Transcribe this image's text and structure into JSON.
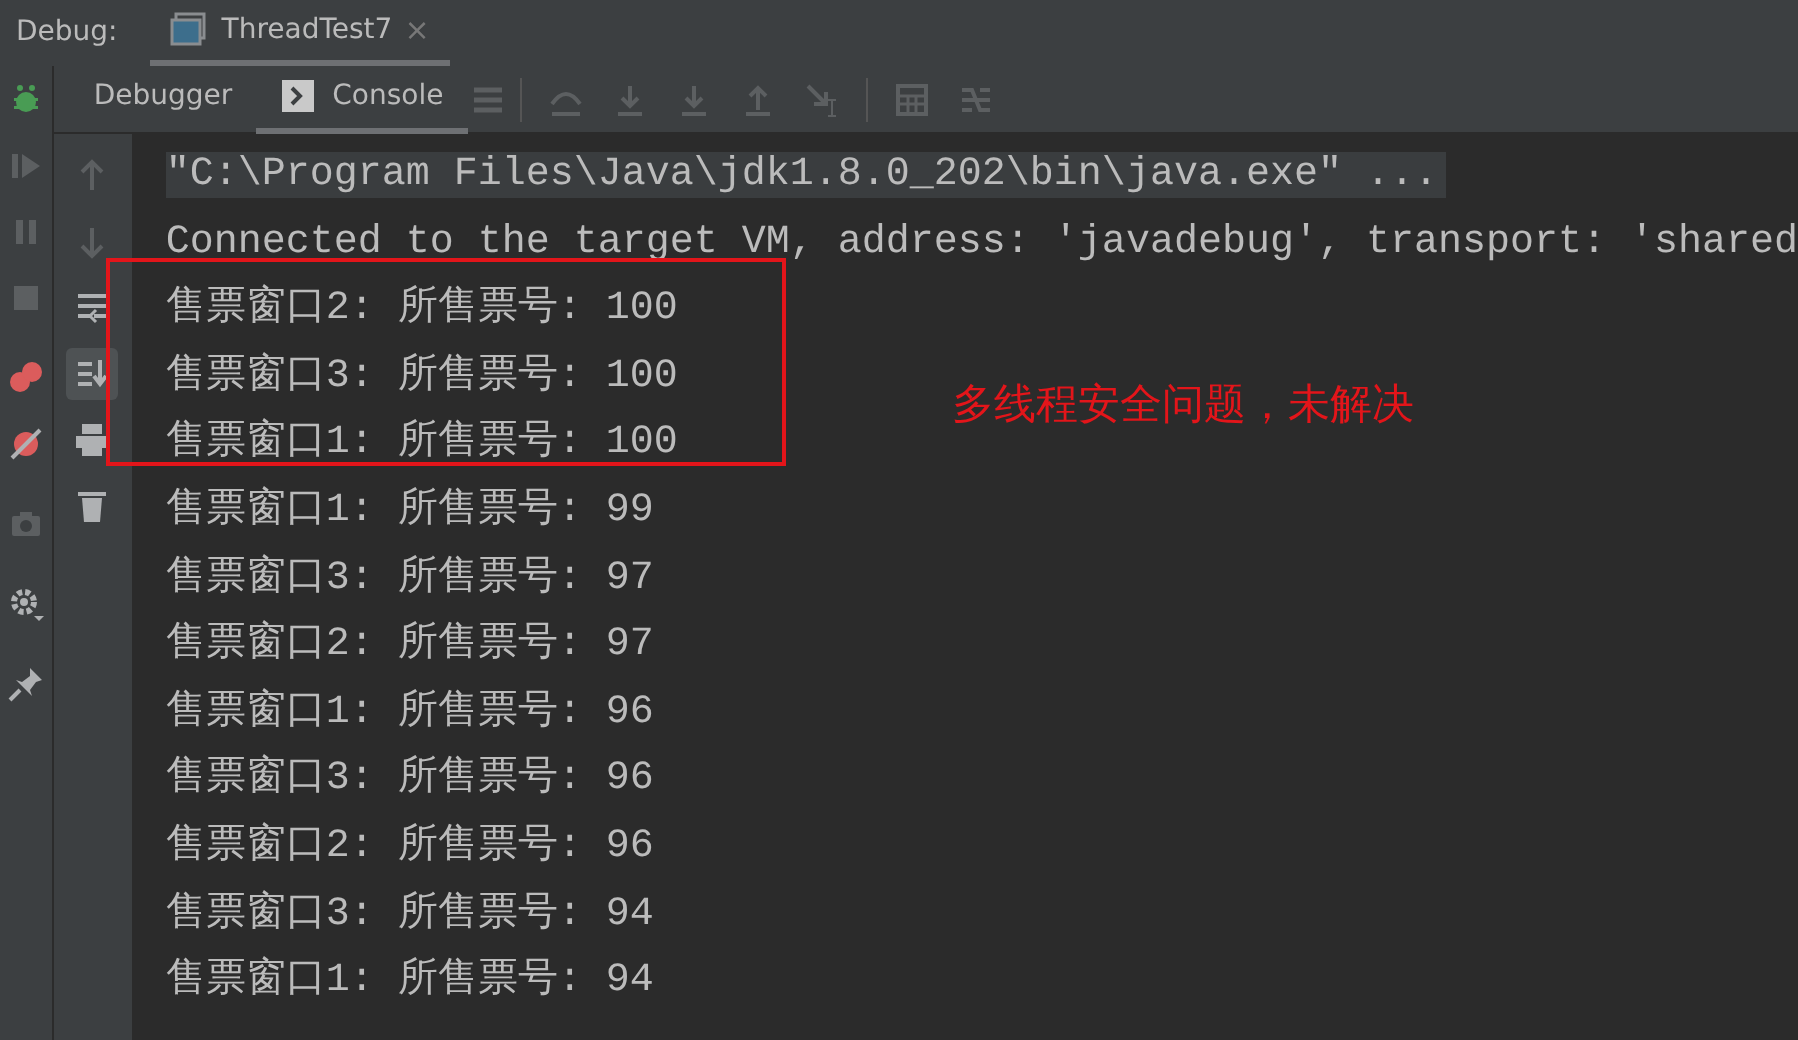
{
  "debug_bar": {
    "label": "Debug:",
    "tab": {
      "title": "ThreadTest7",
      "close": "×"
    }
  },
  "tool_tabs": [
    {
      "label": "Debugger",
      "selected": false
    },
    {
      "label": "Console",
      "selected": true
    }
  ],
  "console": {
    "lines": [
      {
        "text": "\"C:\\Program Files\\Java\\jdk1.8.0_202\\bin\\java.exe\" ...",
        "kind": "command"
      },
      {
        "text": "Connected to the target VM, address: 'javadebug', transport: 'shared",
        "kind": "output"
      },
      {
        "text": "售票窗口2: 所售票号: 100",
        "kind": "output"
      },
      {
        "text": "售票窗口3: 所售票号: 100",
        "kind": "output"
      },
      {
        "text": "售票窗口1: 所售票号: 100",
        "kind": "output"
      },
      {
        "text": "售票窗口1: 所售票号: 99",
        "kind": "output"
      },
      {
        "text": "售票窗口3: 所售票号: 97",
        "kind": "output"
      },
      {
        "text": "售票窗口2: 所售票号: 97",
        "kind": "output"
      },
      {
        "text": "售票窗口1: 所售票号: 96",
        "kind": "output"
      },
      {
        "text": "售票窗口3: 所售票号: 96",
        "kind": "output"
      },
      {
        "text": "售票窗口2: 所售票号: 96",
        "kind": "output"
      },
      {
        "text": "售票窗口3: 所售票号: 94",
        "kind": "output"
      },
      {
        "text": "售票窗口1: 所售票号: 94",
        "kind": "output"
      }
    ]
  },
  "annotation": {
    "text": "多线程安全问题，未解决"
  }
}
